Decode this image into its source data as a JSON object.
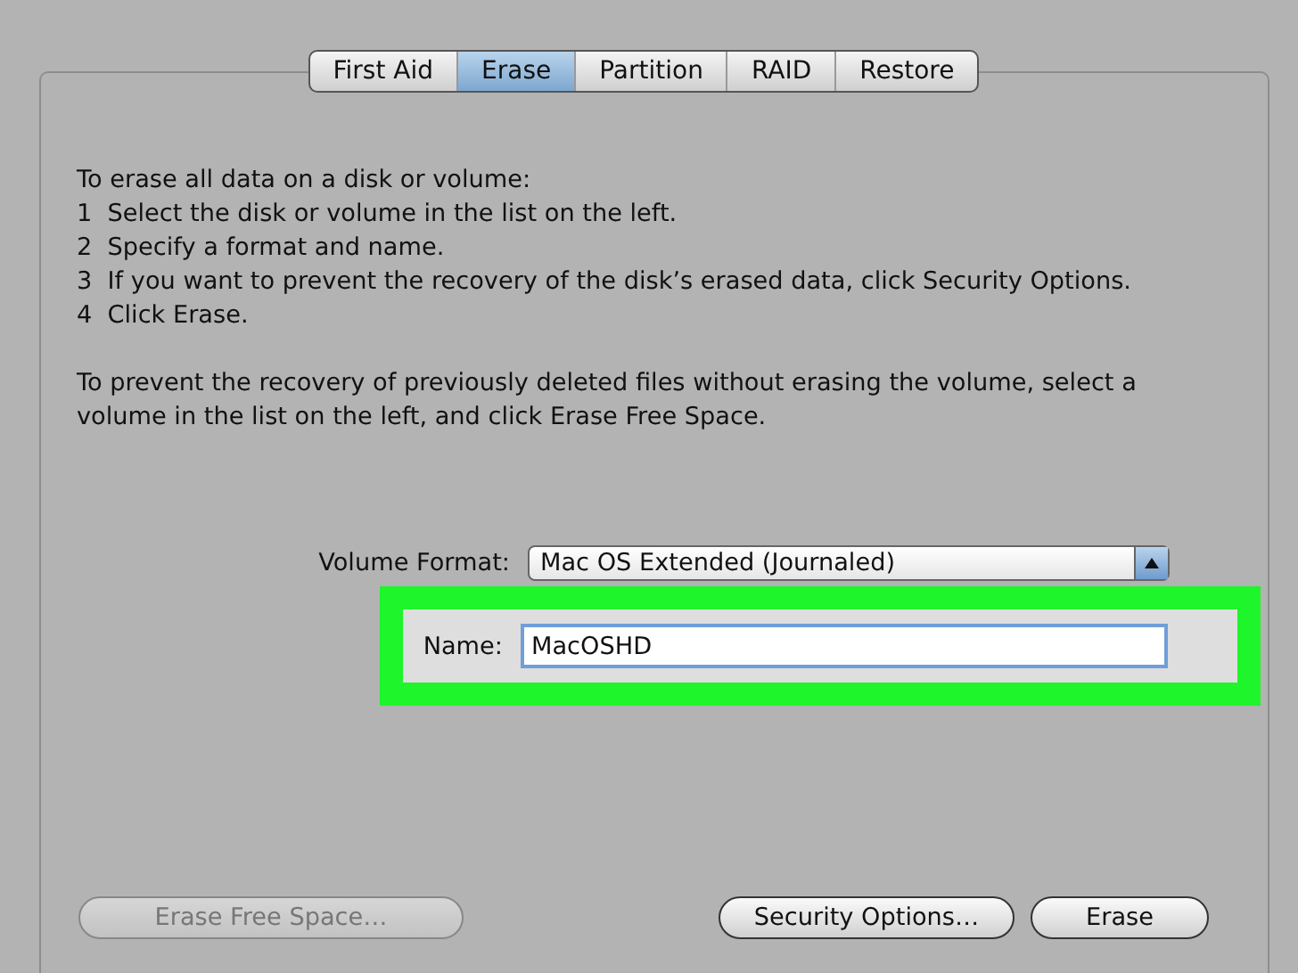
{
  "tabs": [
    {
      "label": "First Aid",
      "selected": false
    },
    {
      "label": "Erase",
      "selected": true
    },
    {
      "label": "Partition",
      "selected": false
    },
    {
      "label": "RAID",
      "selected": false
    },
    {
      "label": "Restore",
      "selected": false
    }
  ],
  "instructions": [
    "To erase all data on a disk or volume:",
    "1  Select the disk or volume in the list on the left.",
    "2  Specify a format and name.",
    "3  If you want to prevent the recovery of the disk’s erased data, click Security Options.",
    "4  Click Erase."
  ],
  "free_space_note": "To prevent the recovery of previously deleted files without erasing the volume, select a volume in the list on the left, and click Erase Free Space.",
  "volume_format": {
    "label": "Volume Format:",
    "value": "Mac OS Extended (Journaled)"
  },
  "name_field": {
    "label": "Name:",
    "value": "MacOSHD",
    "highlighted": true
  },
  "buttons": [
    {
      "label": "Erase Free Space…",
      "disabled": true
    },
    {
      "label": "Security Options…",
      "disabled": false
    },
    {
      "label": "Erase",
      "disabled": false
    }
  ]
}
